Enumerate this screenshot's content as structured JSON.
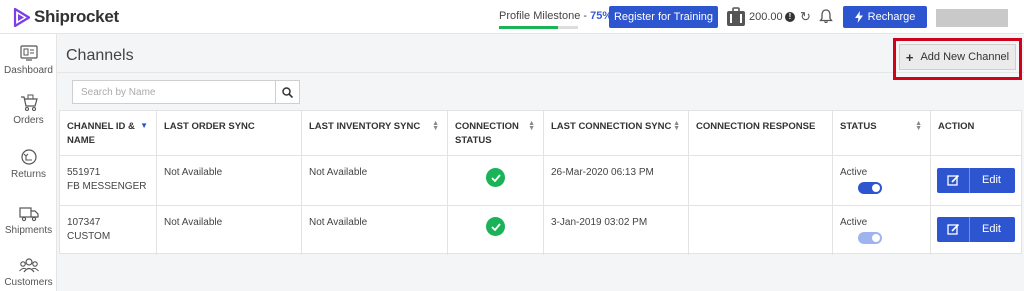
{
  "brand": {
    "name": "Shiprocket"
  },
  "topbar": {
    "milestone_label": "Profile Milestone - ",
    "milestone_percent": "75%",
    "milestone_progress": 0.75,
    "train_label": "Register for Training",
    "balance": "200.00",
    "info_glyph": "!",
    "refresh_glyph": "↻",
    "recharge_label": "Recharge",
    "icons": [
      "wallet-icon",
      "info-icon",
      "refresh-icon",
      "bell-icon",
      "bolt-icon"
    ]
  },
  "sidebar": {
    "items": [
      {
        "label": "Dashboard",
        "icon": "dashboard-icon"
      },
      {
        "label": "Orders",
        "icon": "orders-icon"
      },
      {
        "label": "Returns",
        "icon": "returns-icon"
      },
      {
        "label": "Shipments",
        "icon": "shipments-icon"
      },
      {
        "label": "Customers",
        "icon": "customers-icon"
      }
    ]
  },
  "page": {
    "title": "Channels",
    "add_label": "Add New Channel",
    "add_glyph": "+"
  },
  "search": {
    "placeholder": "Search by Name"
  },
  "table": {
    "columns": [
      "CHANNEL ID & NAME",
      "LAST ORDER SYNC",
      "LAST INVENTORY SYNC",
      "CONNECTION STATUS",
      "LAST CONNECTION SYNC",
      "CONNECTION RESPONSE",
      "STATUS",
      "ACTION"
    ],
    "sort_glyph_active": "▼",
    "sort_glyph": "▲▼",
    "rows": [
      {
        "id": "551971",
        "name": "FB MESSENGER",
        "last_order_sync": "Not Available",
        "last_inventory_sync": "Not Available",
        "connection_status": "connected",
        "last_connection_sync": "26-Mar-2020 06:13 PM",
        "connection_response": "",
        "status": "Active",
        "action_label": "Edit"
      },
      {
        "id": "107347",
        "name": "CUSTOM",
        "last_order_sync": "Not Available",
        "last_inventory_sync": "Not Available",
        "connection_status": "connected",
        "last_connection_sync": "3-Jan-2019 03:02 PM",
        "connection_response": "",
        "status": "Active",
        "action_label": "Edit"
      }
    ]
  },
  "colors": {
    "primary": "#2c55cf",
    "success": "#1bb357",
    "highlight": "#d0021b"
  }
}
